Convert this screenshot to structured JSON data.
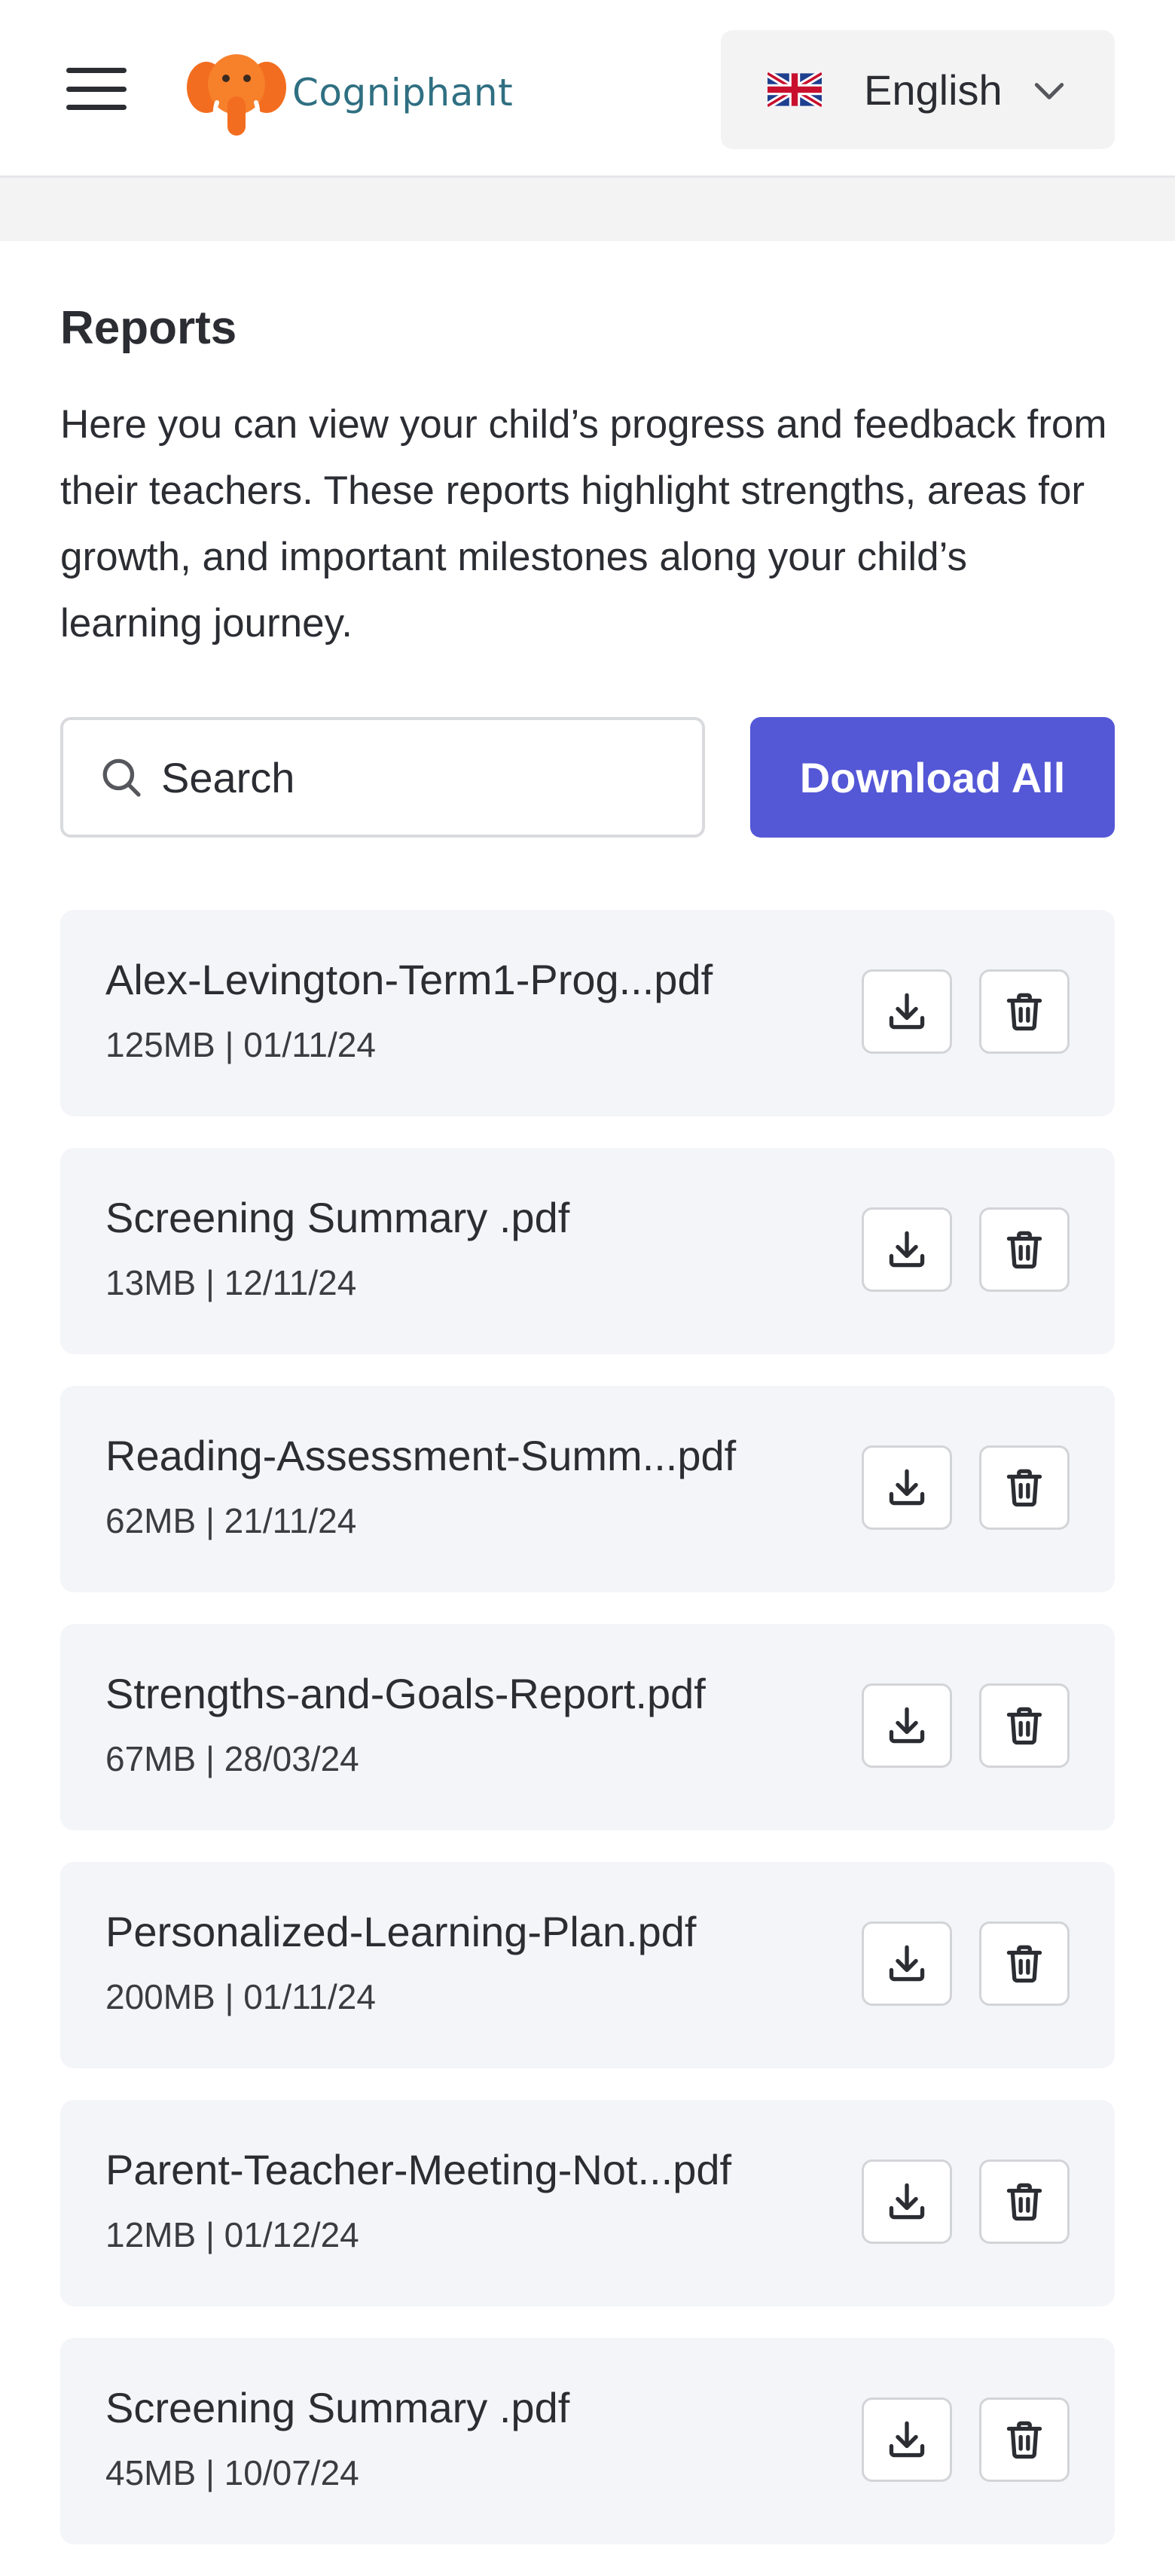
{
  "header": {
    "menu_icon": "hamburger-menu-icon",
    "logo_text": "Cogniphant",
    "language": {
      "flag_icon": "uk-flag-icon",
      "selected": "English",
      "chevron_icon": "chevron-down-icon"
    }
  },
  "reports": {
    "title": "Reports",
    "description": "Here you can view your child’s progress and feedback from their teachers. These reports highlight strengths, areas for growth, and important milestones along your child’s learning journey.",
    "search_placeholder": "Search",
    "search_value": "",
    "download_all_label": "Download All"
  },
  "files": [
    {
      "name": "Alex-Levington-Term1-Prog...pdf",
      "meta": "125MB | 01/11/24"
    },
    {
      "name": "Screening Summary .pdf",
      "meta": "13MB | 12/11/24"
    },
    {
      "name": "Reading-Assessment-Summ...pdf",
      "meta": "62MB | 21/11/24"
    },
    {
      "name": "Strengths-and-Goals-Report.pdf",
      "meta": "67MB | 28/03/24"
    },
    {
      "name": "Personalized-Learning-Plan.pdf",
      "meta": "200MB | 01/11/24"
    },
    {
      "name": "Parent-Teacher-Meeting-Not...pdf",
      "meta": "12MB | 01/12/24"
    },
    {
      "name": "Screening Summary .pdf",
      "meta": "45MB | 10/07/24"
    }
  ],
  "icons": {
    "search": "search-icon",
    "download": "download-icon",
    "delete": "trash-icon"
  },
  "colors": {
    "accent": "#5457d6",
    "card_bg": "#f4f5f9",
    "logo_orange": "#f26d1f",
    "logo_text": "#2f6f82"
  }
}
